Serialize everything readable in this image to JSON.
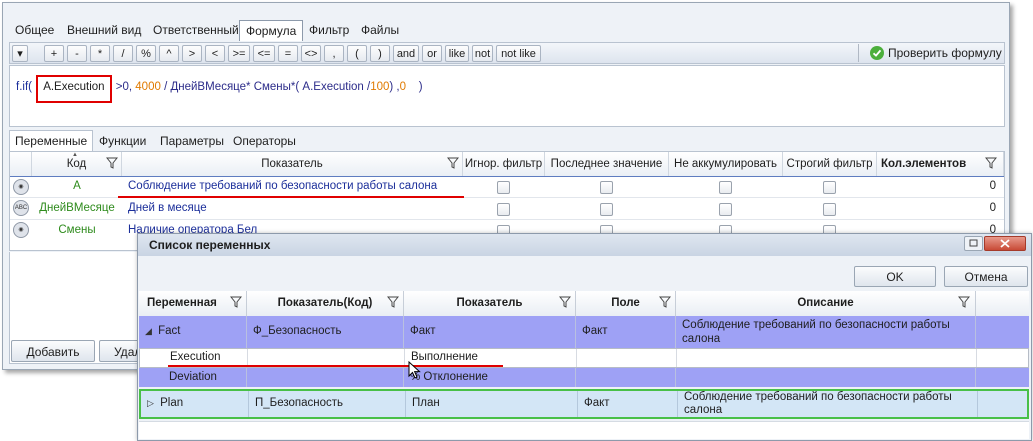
{
  "tabs": [
    "Общее",
    "Внешний вид",
    "Ответственный",
    "Формула",
    "Фильтр",
    "Файлы"
  ],
  "toolbar": {
    "operators": [
      "+",
      "-",
      "*",
      "/",
      "%",
      "^",
      ">",
      "<",
      ">=",
      "<=",
      "=",
      "<>",
      ",",
      "(",
      ")",
      "and",
      "or",
      "like",
      "not",
      "not like"
    ],
    "check_label": "Проверить формулу"
  },
  "formula": {
    "prefix": "f.if(",
    "highlight": "A.Execution",
    "part1": ">0, ",
    "num1": "4000",
    "part2": " / ДнейВМесяце* Смены*( A.Execution /",
    "num2": "100",
    "part3": ")  ,",
    "num3": "0",
    "part4": "    )"
  },
  "subtabs": [
    "Переменные",
    "Функции",
    "Параметры",
    "Операторы"
  ],
  "vars": {
    "headers": {
      "code": "Код",
      "indicator": "Показатель",
      "ignore_filter": "Игнор. фильтр",
      "last_value": "Последнее значение",
      "not_accum": "Не аккумулировать",
      "strict_filter": "Строгий фильтр",
      "count": "Кол.элементов"
    },
    "rows": [
      {
        "code": "A",
        "indicator": "Соблюдение требований по безопасности работы салона",
        "count": "0"
      },
      {
        "code": "ДнейВМесяце",
        "indicator": "Дней в месяце",
        "count": "0"
      },
      {
        "code": "Смены",
        "indicator": "Наличие оператора Бел",
        "count": "0"
      }
    ]
  },
  "buttons": {
    "add": "Добавить",
    "delete": "Удал"
  },
  "dialog": {
    "title": "Список переменных",
    "ok": "OK",
    "cancel": "Отмена",
    "headers": {
      "variable": "Переменная",
      "indicator_code": "Показатель(Код)",
      "indicator": "Показатель",
      "field": "Поле",
      "description": "Описание"
    },
    "rows": [
      {
        "variable": "Fact",
        "indicator_code": "Ф_Безопасность",
        "indicator": "Факт",
        "field": "Факт",
        "description": "Соблюдение требований по безопасности работы салона"
      },
      {
        "variable": "Execution",
        "indicator_code": "",
        "indicator": "Выполнение",
        "field": "",
        "description": ""
      },
      {
        "variable": "Deviation",
        "indicator_code": "",
        "indicator": "% Отклонение",
        "field": "",
        "description": ""
      },
      {
        "variable": "Plan",
        "indicator_code": "П_Безопасность",
        "indicator": "План",
        "field": "Факт",
        "description": "Соблюдение требований по безопасности работы салона"
      }
    ]
  },
  "colors": {
    "accent_red": "#e00000",
    "group_row": "#9ea1f5",
    "selected_green": "#48c048"
  }
}
